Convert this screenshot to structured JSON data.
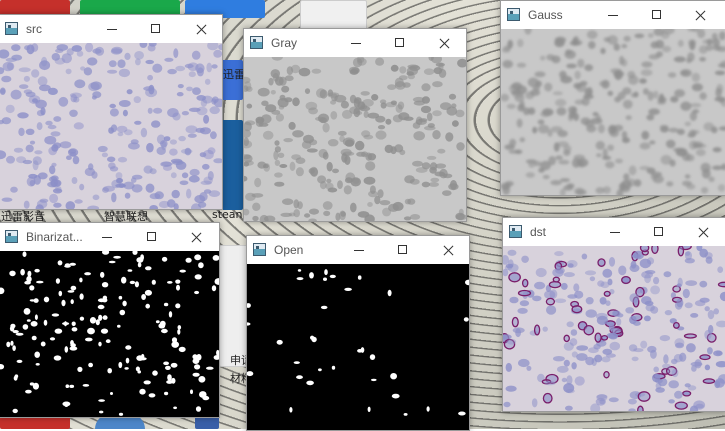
{
  "desktop": {
    "labels": [
      "迅雷影音",
      "智慧联想",
      "stean"
    ],
    "labels_right": [
      "迅雷",
      "申请",
      "材料"
    ]
  },
  "windows": [
    {
      "id": "src",
      "title": "src",
      "kind": "cells-color"
    },
    {
      "id": "gray",
      "title": "Gray",
      "kind": "cells-gray"
    },
    {
      "id": "gauss",
      "title": "Gauss",
      "kind": "cells-blur"
    },
    {
      "id": "binarization",
      "title": "Binarizat...",
      "kind": "binary-dense"
    },
    {
      "id": "open",
      "title": "Open",
      "kind": "binary-sparse"
    },
    {
      "id": "dst",
      "title": "dst",
      "kind": "cells-contours"
    }
  ],
  "colors": {
    "stain_bg": "#d8d2dc",
    "nucleus": "#8c8fc8",
    "gray_bg": "#c8c8c8",
    "gray_nucleus": "#8f8f8f",
    "contour": "#7a1e6a"
  }
}
